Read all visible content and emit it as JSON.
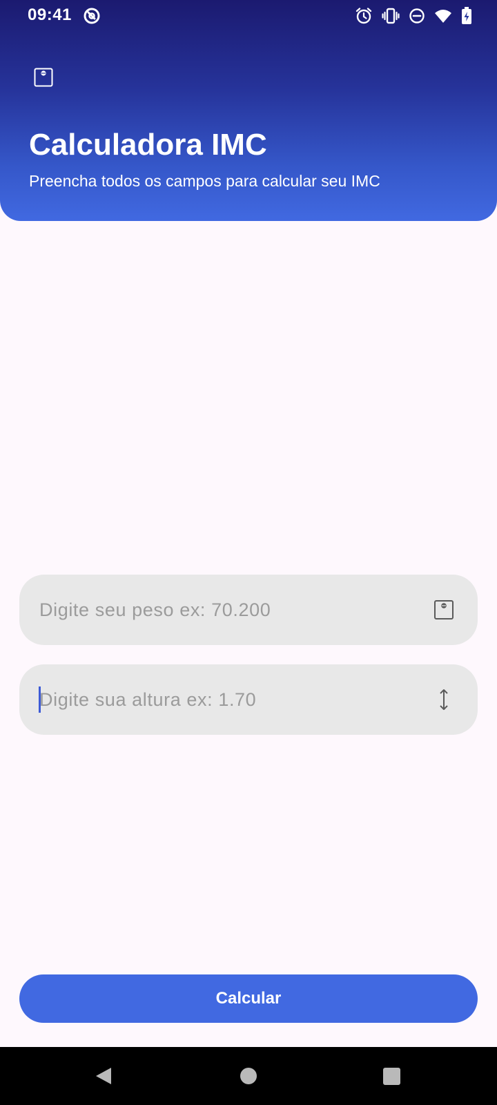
{
  "status_bar": {
    "time": "09:41",
    "icons": [
      "app-notification-icon",
      "alarm-icon",
      "vibrate-icon",
      "do-not-disturb-icon",
      "wifi-icon",
      "battery-charging-icon"
    ]
  },
  "header": {
    "icon": "scale-icon",
    "title": "Calculadora IMC",
    "subtitle": "Preencha todos os campos para calcular seu IMC"
  },
  "form": {
    "weight": {
      "placeholder": "Digite seu peso ex: 70.200",
      "value": "",
      "icon": "scale-icon"
    },
    "height": {
      "placeholder": "Digite sua altura ex: 1.70",
      "value": "",
      "icon": "height-icon",
      "focused": true
    }
  },
  "actions": {
    "calculate_label": "Calcular"
  },
  "navigation": {
    "buttons": [
      "back",
      "home",
      "recents"
    ]
  },
  "colors": {
    "header_gradient_top": "#1B1A70",
    "header_gradient_bottom": "#4169E1",
    "background": "#FEF8FD",
    "field_background": "#E8E8E8",
    "accent": "#4169E1",
    "placeholder_text": "#9B9B9B"
  }
}
